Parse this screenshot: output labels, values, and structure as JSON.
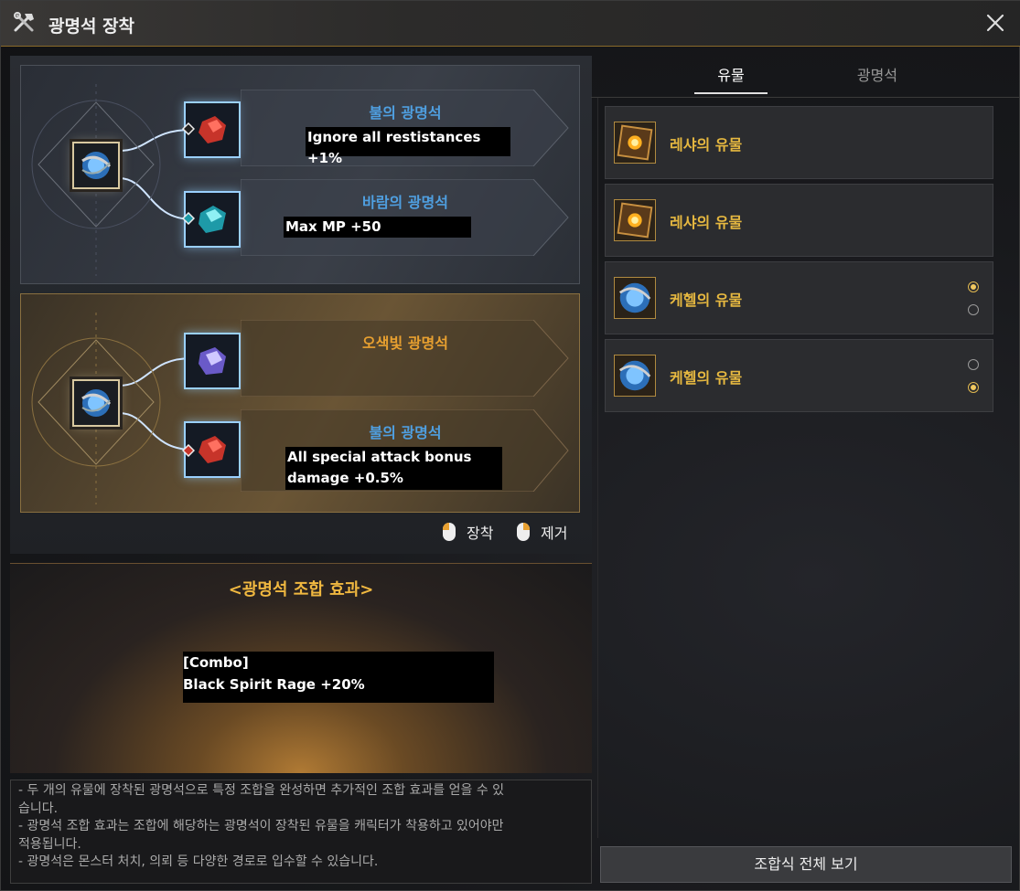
{
  "window": {
    "title": "광명석 장착"
  },
  "icons": {
    "title": "crossed-tools-icon",
    "close": "close-icon",
    "mouse": "mouse-icon"
  },
  "sets": [
    {
      "gems": [
        {
          "name": "불의 광명석",
          "name_color": "#4f9fe0",
          "gem": "red-gem",
          "effect": "Ignore all restistances +1%"
        },
        {
          "name": "바람의 광명석",
          "name_color": "#4f9fe0",
          "gem": "cyan-gem",
          "effect": "Max MP +50"
        }
      ]
    },
    {
      "gems": [
        {
          "name": "오색빛 광명석",
          "name_color": "#e8a030",
          "gem": "purple-gem",
          "effect": ""
        },
        {
          "name": "불의 광명석",
          "name_color": "#4f9fe0",
          "gem": "red-gem",
          "effect_line1": "All special attack bonus",
          "effect_line2": "damage +0.5%"
        }
      ]
    }
  ],
  "hints": {
    "equip": "장착",
    "remove": "제거"
  },
  "combo": {
    "title": "<광명석 조합 효과>",
    "line1": "[Combo]",
    "line2": "Black Spirit Rage +20%"
  },
  "notes": [
    "- 두 개의 유물에 장착된 광명석으로 특정 조합을 완성하면 추가적인 조합 효과를 얻을 수 있",
    "습니다.",
    "- 광명석 조합 효과는 조합에 해당하는 광명석이 장착된 유물을 캐릭터가 착용하고 있어야만",
    "적용됩니다.",
    "- 광명석은 몬스터 처치, 의뢰 등 다양한 경로로 입수할 수 있습니다."
  ],
  "tabs": [
    {
      "label": "유물",
      "active": true
    },
    {
      "label": "광명석",
      "active": false
    }
  ],
  "relics": [
    {
      "name": "레샤의 유물",
      "icon": "lesha-relic-icon"
    },
    {
      "name": "레샤의 유물",
      "icon": "lesha-relic-icon"
    },
    {
      "name": "케헬의 유물",
      "icon": "kehel-relic-icon",
      "radio_top": true,
      "radio_bottom": false
    },
    {
      "name": "케헬의 유물",
      "icon": "kehel-relic-icon",
      "radio_top": false,
      "radio_bottom": true
    }
  ],
  "buttons": {
    "view_all": "조합식 전체 보기"
  },
  "colors": {
    "accent_gold": "#e6b840",
    "gem_name_blue": "#4f9fe0",
    "combo_title": "#f0b840"
  }
}
